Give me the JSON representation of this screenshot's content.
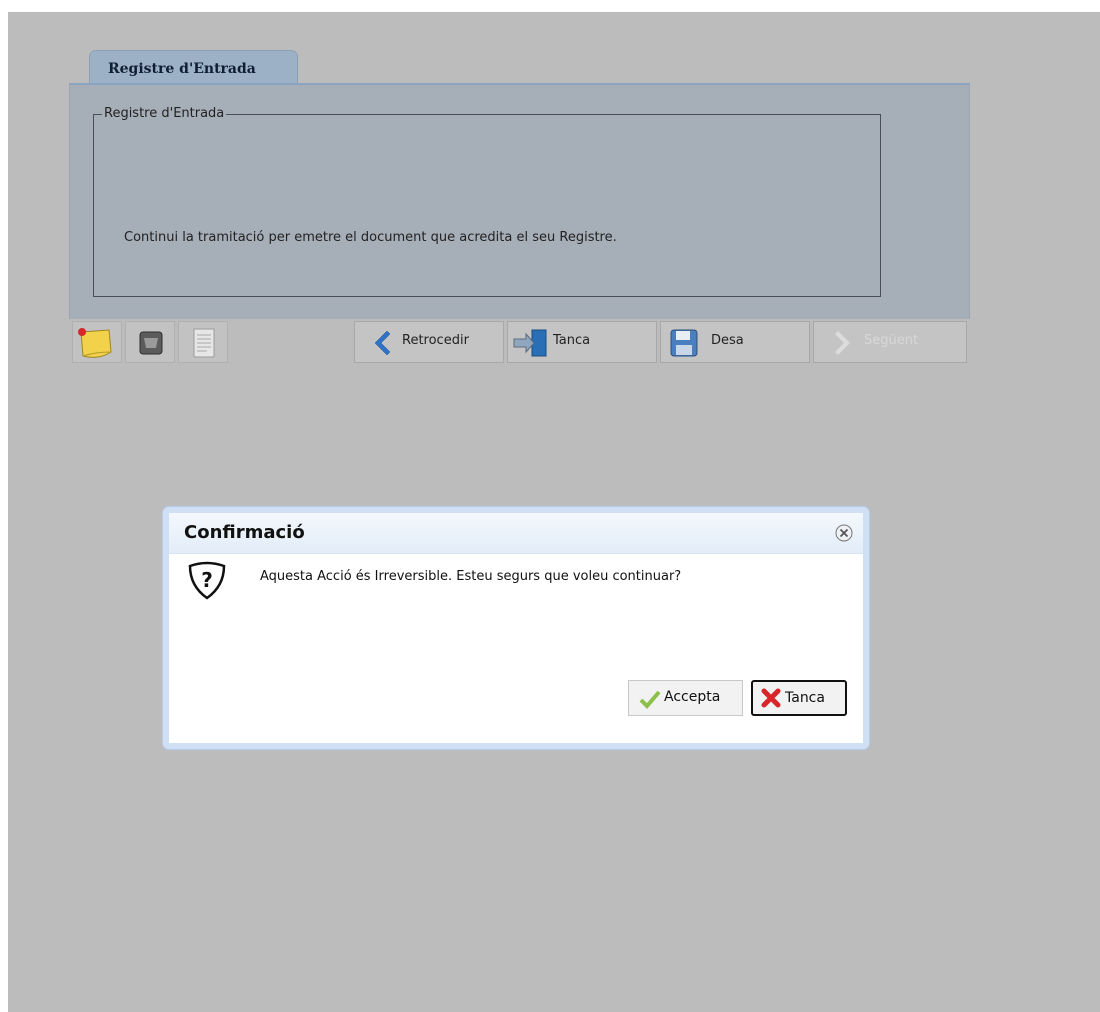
{
  "tab": {
    "label": "Registre d'Entrada"
  },
  "panel": {
    "legend": "Registre d'Entrada",
    "message": "Continui la tramitació per emetre el document que acredita el seu Registre."
  },
  "toolbar": {
    "icons": [
      "sticky-note-icon",
      "box-icon",
      "document-icon"
    ],
    "back_label": "Retrocedir",
    "close_label": "Tanca",
    "save_label": "Desa",
    "next_label": "Següent"
  },
  "dialog": {
    "title": "Confirmació",
    "message": "Aquesta Acció és Irreversible. Esteu segurs que voleu continuar?",
    "accept_label": "Accepta",
    "close_label": "Tanca"
  },
  "colors": {
    "overlay": "#bcbcbc",
    "tab": "#9db1c6",
    "panel": "#a6aeb7",
    "dialog_border": "#cfe0f5"
  }
}
